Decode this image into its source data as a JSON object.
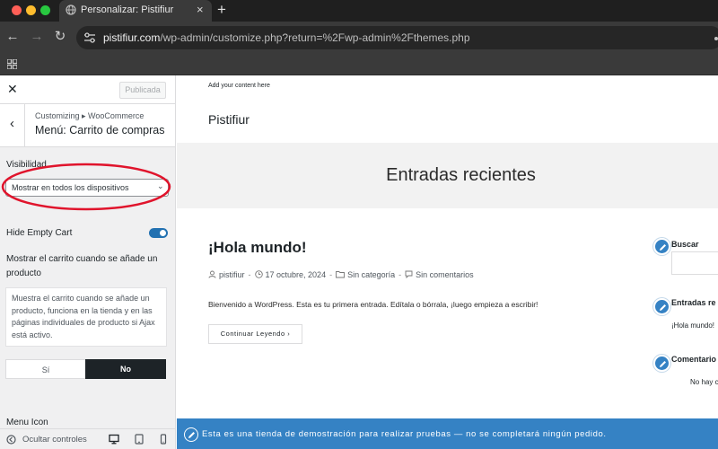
{
  "browser": {
    "tab_title": "Personalizar: Pistifiur",
    "tab_close": "×",
    "new_tab": "+",
    "url_domain": "pistifiur.com",
    "url_path": "/wp-admin/customize.php?return=%2Fwp-admin%2Fthemes.php"
  },
  "customizer": {
    "close": "✕",
    "publish_label": "Publicada",
    "back": "‹",
    "breadcrumb": "Customizing ▸ WooCommerce",
    "section_title": "Menú: Carrito de compras",
    "visibility_label": "Visibilidad",
    "visibility_value": "Mostrar en todos los dispositivos",
    "hide_empty_cart_label": "Hide Empty Cart",
    "hide_empty_cart_on": true,
    "show_cart_label": "Mostrar el carrito cuando se añade un producto",
    "show_cart_description": "Muestra el carrito cuando se añade un producto, funciona en la tienda y en las páginas individuales de producto si Ajax está activo.",
    "option_yes": "Sí",
    "option_no": "No",
    "menu_icon_label": "Menu Icon",
    "hide_controls": "Ocultar controles",
    "annotation_color": "#e0142c",
    "accent_color": "#2271b1"
  },
  "preview": {
    "add_content": "Add your content here",
    "site_title": "Pistifiur",
    "recent_posts_heading": "Entradas recientes",
    "post": {
      "title": "¡Hola mundo!",
      "author": "pistifiur",
      "date": "17 octubre, 2024",
      "category": "Sin categoría",
      "comments": "Sin comentarios",
      "excerpt": "Bienvenido a WordPress. Esta es tu primera entrada. Edítala o bórrala, ¡luego empieza a escribir!",
      "continue_label": "Continuar Leyendo",
      "continue_arrow": "›"
    },
    "widgets": {
      "search_title": "Buscar",
      "recent_title": "Entradas re",
      "recent_item": "¡Hola mundo!",
      "comments_title": "Comentario",
      "comments_item": "No hay c"
    },
    "demo_notice": "Esta es una tienda de demostración para realizar pruebas — no se completará ningún pedido.",
    "demo_color": "#3582c4"
  }
}
